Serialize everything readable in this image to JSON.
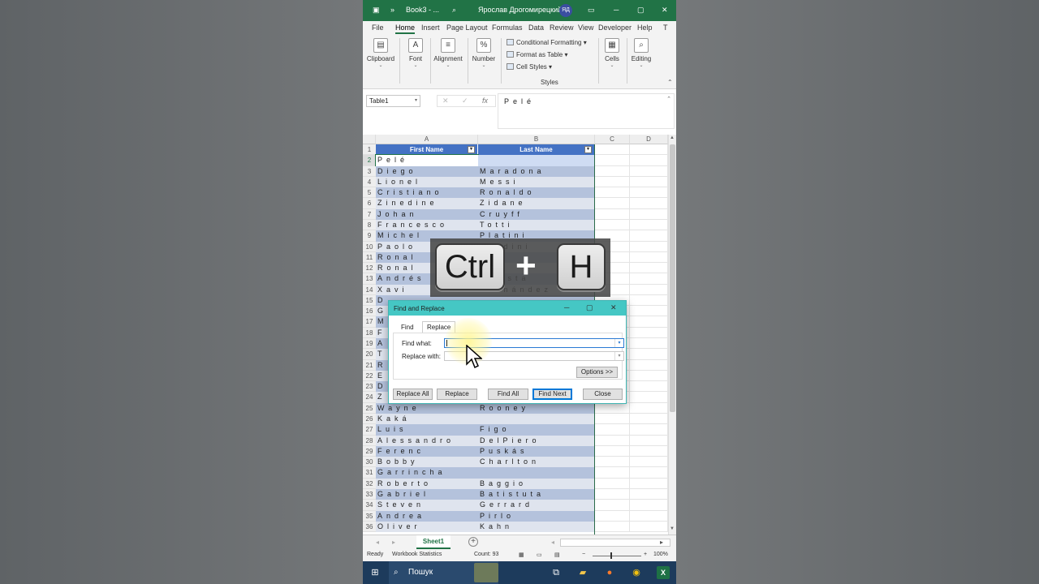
{
  "titlebar": {
    "doc_title": "Book3 - ...",
    "user_name": "Ярослав Дрогомирецкий",
    "user_initials": "ЯД",
    "colors": {
      "excel_green": "#217346"
    }
  },
  "menu_tabs": [
    "File",
    "Home",
    "Insert",
    "Page Layout",
    "Formulas",
    "Data",
    "Review",
    "View",
    "Developer",
    "Help",
    "T"
  ],
  "ribbon": {
    "clipboard": "Clipboard",
    "font": "Font",
    "alignment": "Alignment",
    "number": "Number",
    "conditional_formatting": "Conditional Formatting",
    "format_as_table": "Format as Table",
    "cell_styles": "Cell Styles",
    "styles_group": "Styles",
    "cells": "Cells",
    "editing": "Editing"
  },
  "formula_bar": {
    "name_box": "Table1",
    "cancel_icon": "✕",
    "enter_icon": "✓",
    "fx_label": "fx",
    "content": "Pelé"
  },
  "columns": [
    "A",
    "B",
    "C",
    "D"
  ],
  "table": {
    "header_a": "First Name",
    "header_b": "Last Name",
    "rows": [
      {
        "n": "2",
        "a": "Pelé",
        "b": ""
      },
      {
        "n": "3",
        "a": "Diego",
        "b": "Maradona"
      },
      {
        "n": "4",
        "a": "Lionel",
        "b": "Messi"
      },
      {
        "n": "5",
        "a": "Cristiano",
        "b": "Ronaldo"
      },
      {
        "n": "6",
        "a": "Zinedine",
        "b": "Zidane"
      },
      {
        "n": "7",
        "a": "Johan",
        "b": "Cruyff"
      },
      {
        "n": "8",
        "a": "Francesco",
        "b": "Totti"
      },
      {
        "n": "9",
        "a": "Michel",
        "b": "Platini"
      },
      {
        "n": "10",
        "a": "Paolo",
        "b": "Maldini"
      },
      {
        "n": "11",
        "a": "Ronal",
        "b": ""
      },
      {
        "n": "12",
        "a": "Ronal",
        "b": ""
      },
      {
        "n": "13",
        "a": "Andrés",
        "b": "Iniesta"
      },
      {
        "n": "14",
        "a": "Xavi",
        "b": "Hernández"
      },
      {
        "n": "15",
        "a": "D",
        "b": ""
      },
      {
        "n": "16",
        "a": "G",
        "b": ""
      },
      {
        "n": "17",
        "a": "M",
        "b": ""
      },
      {
        "n": "18",
        "a": "F",
        "b": ""
      },
      {
        "n": "19",
        "a": "A",
        "b": ""
      },
      {
        "n": "20",
        "a": "T",
        "b": ""
      },
      {
        "n": "21",
        "a": "R",
        "b": ""
      },
      {
        "n": "22",
        "a": "E",
        "b": ""
      },
      {
        "n": "23",
        "a": "D",
        "b": ""
      },
      {
        "n": "24",
        "a": "Z",
        "b": ""
      },
      {
        "n": "25",
        "a": "Wayne",
        "b": "Rooney"
      },
      {
        "n": "26",
        "a": "Kaká",
        "b": ""
      },
      {
        "n": "27",
        "a": "Luis",
        "b": "Figo"
      },
      {
        "n": "28",
        "a": "Alessandro",
        "b": "DelPiero"
      },
      {
        "n": "29",
        "a": "Ferenc",
        "b": "Puskás"
      },
      {
        "n": "30",
        "a": "Bobby",
        "b": "Charlton"
      },
      {
        "n": "31",
        "a": "Garrincha",
        "b": ""
      },
      {
        "n": "32",
        "a": "Roberto",
        "b": "Baggio"
      },
      {
        "n": "33",
        "a": "Gabriel",
        "b": "Batistuta"
      },
      {
        "n": "34",
        "a": "Steven",
        "b": "Gerrard"
      },
      {
        "n": "35",
        "a": "Andrea",
        "b": "Pirlo"
      },
      {
        "n": "36",
        "a": "Oliver",
        "b": "Kahn"
      }
    ],
    "colors": {
      "header": "#4472c4",
      "band_dark": "#b4c2dc",
      "band_light": "#dfe4ee",
      "selected": "#cfdcf3"
    }
  },
  "overlay": {
    "key1": "Ctrl",
    "plus": "+",
    "key2": "H"
  },
  "dialog": {
    "title": "Find and Replace",
    "tab_find": "Find",
    "tab_replace": "Replace",
    "find_label": "Find what:",
    "replace_label": "Replace with:",
    "find_value": "",
    "replace_value": "",
    "options": "Options >>",
    "replace_all": "Replace All",
    "replace": "Replace",
    "find_all": "Find All",
    "find_next": "Find Next",
    "close": "Close"
  },
  "sheet": {
    "tab": "Sheet1",
    "add": "+"
  },
  "status": {
    "ready": "Ready",
    "workbook_stats": "Workbook Statistics",
    "count": "Count: 93",
    "zoom": "100%",
    "zoom_minus": "−",
    "zoom_plus": "+"
  },
  "taskbar": {
    "search_label": "Пошук"
  }
}
